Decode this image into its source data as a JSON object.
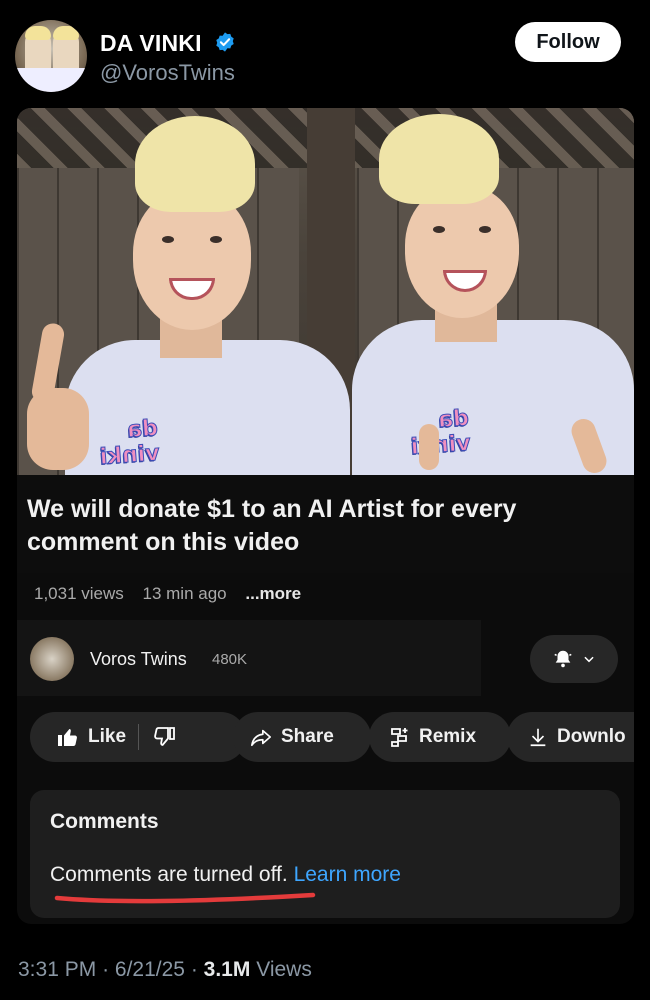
{
  "tweet": {
    "display_name": "DA VINKI",
    "handle": "@VorosTwins",
    "follow_label": "Follow",
    "verified_icon": "verified-badge-icon",
    "verified_color": "#1d9bf0"
  },
  "video": {
    "shirt_text": "da vinki",
    "title": "We will donate $1 to an AI Artist for every comment on this video",
    "views": "1,031 views",
    "age": "13 min ago",
    "more_label": "...more",
    "channel_name": "Voros Twins",
    "subscribers": "480K",
    "actions": {
      "like": "Like",
      "share": "Share",
      "remix": "Remix",
      "download": "Downlo"
    },
    "comments": {
      "title": "Comments",
      "status": "Comments are turned off.",
      "learn_more": "Learn more",
      "link_color": "#3ea6ff"
    }
  },
  "footer": {
    "time": "3:31 PM",
    "date": "6/21/25",
    "views_count": "3.1M",
    "views_label": "Views",
    "separator": "·"
  }
}
